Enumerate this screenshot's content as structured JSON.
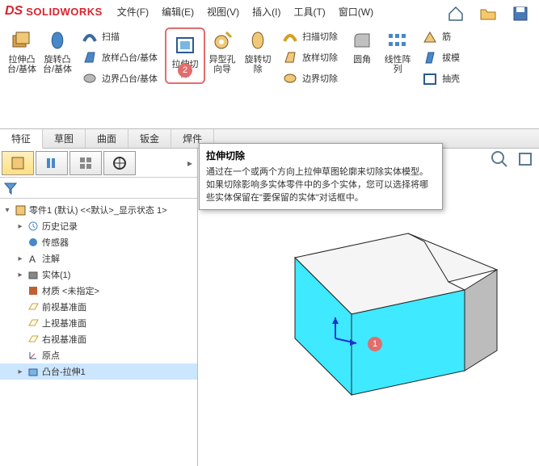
{
  "app": {
    "brand": "SOLIDWORKS"
  },
  "menu": {
    "file": "文件(F)",
    "edit": "编辑(E)",
    "view": "视图(V)",
    "insert": "插入(I)",
    "tools": "工具(T)",
    "window": "窗口(W)"
  },
  "ribbon": {
    "extrude_boss": "拉伸凸\n台/基体",
    "revolve_boss": "旋转凸\n台/基体",
    "sweep": "扫描",
    "loft_boss": "放样凸台/基体",
    "boundary_boss": "边界凸台/基体",
    "extrude_cut": "拉伸切\n除",
    "hole_wizard": "异型孔\n向导",
    "revolve_cut": "旋转切\n除",
    "sweep_cut": "扫描切除",
    "loft_cut": "放样切除",
    "boundary_cut": "边界切除",
    "fillet": "圆角",
    "linear_pattern": "线性阵\n列",
    "rib": "筋",
    "draft": "拔模",
    "shell": "抽壳"
  },
  "badges": {
    "step1": "1",
    "step2": "2"
  },
  "tabs": {
    "feature": "特征",
    "sketch": "草图",
    "surface": "曲面",
    "sheetmetal": "钣金",
    "weld": "焊件"
  },
  "tooltip": {
    "title": "拉伸切除",
    "body": "通过在一个或两个方向上拉伸草图轮廓来切除实体模型。\n如果切除影响多实体零件中的多个实体，您可以选择将哪些实体保留在\"要保留的实体\"对话框中。"
  },
  "tree": {
    "root": "零件1 (默认) <<默认>_显示状态 1>",
    "history": "历史记录",
    "sensors": "传感器",
    "annotations": "注解",
    "solid_bodies": "实体(1)",
    "material": "材质 <未指定>",
    "front_plane": "前视基准面",
    "top_plane": "上视基准面",
    "right_plane": "右视基准面",
    "origin": "原点",
    "feature1": "凸台-拉伸1"
  }
}
